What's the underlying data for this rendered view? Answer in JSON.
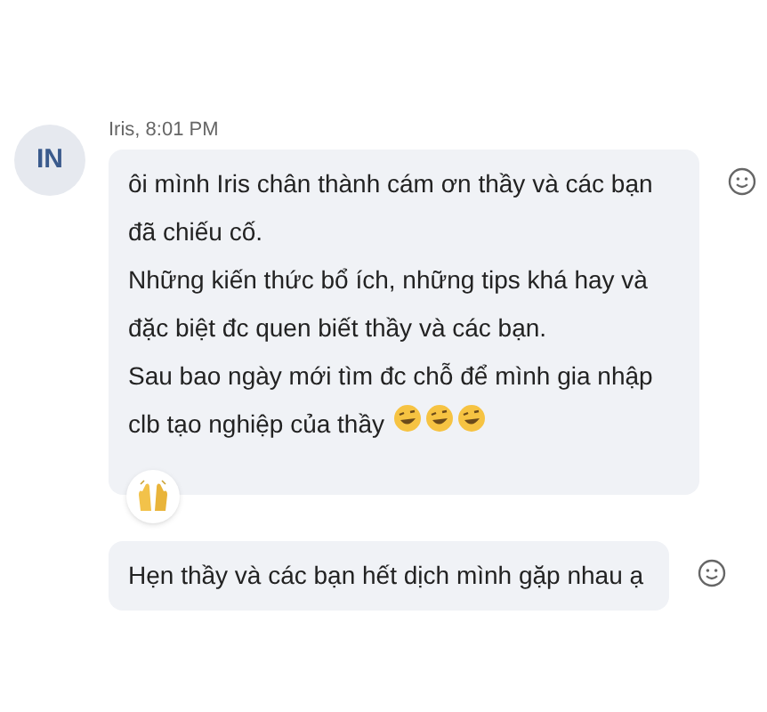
{
  "sender": {
    "initials": "IN",
    "meta": "Iris, 8:01 PM"
  },
  "messages": [
    {
      "lines": [
        "ôi mình Iris chân thành cám ơn thầy và các bạn",
        "đã chiếu cố.",
        "Những kiến thức bổ ích, những tips khá hay và",
        "đặc biệt đc quen biết thầy và các bạn.",
        "Sau bao ngày mới tìm đc chỗ để mình gia nhập",
        "clb tạo nghiệp của thầy"
      ],
      "trailing_emoji": true,
      "reaction": true
    },
    {
      "lines": [
        "Hẹn thầy và các bạn hết dịch mình gặp nhau ạ"
      ],
      "trailing_emoji": false,
      "reaction": false
    }
  ]
}
